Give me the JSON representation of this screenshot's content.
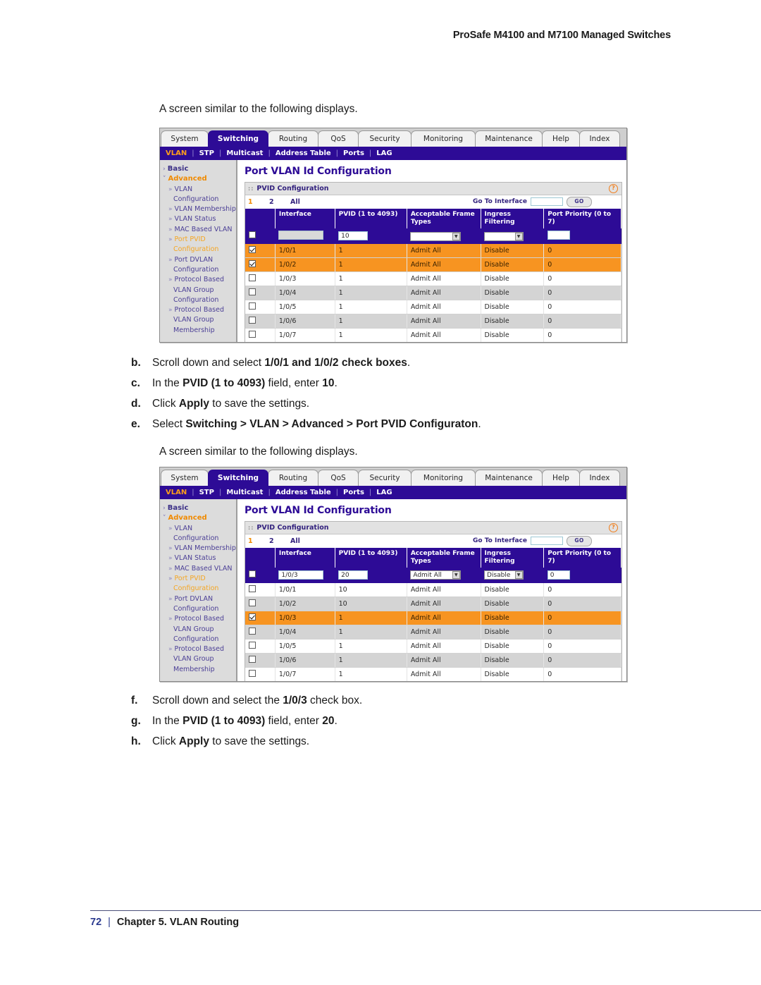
{
  "running_head": "ProSafe M4100 and M7100 Managed Switches",
  "lead_in_1": "A screen similar to the following displays.",
  "lead_in_2": "A screen similar to the following displays.",
  "steps_upper": [
    {
      "marker": "b.",
      "html": "Scroll down and select <b>1/0/1 and 1/0/2 check boxes</b>."
    },
    {
      "marker": "c.",
      "html": "In the <b>PVID (1 to 4093)</b> field, enter <b>10</b>."
    },
    {
      "marker": "d.",
      "html": "Click <b>Apply</b> to save the settings."
    },
    {
      "marker": "e.",
      "html": "Select <b>Switching &gt; VLAN &gt; Advanced &gt; Port PVID Configuraton</b>."
    }
  ],
  "steps_lower": [
    {
      "marker": "f.",
      "html": "Scroll down and select the <b>1/0/3</b> check box."
    },
    {
      "marker": "g.",
      "html": "In the <b>PVID (1 to 4093)</b> field, enter <b>20</b>."
    },
    {
      "marker": "h.",
      "html": "Click <b>Apply</b> to save the settings."
    }
  ],
  "footer": {
    "page_number": "72",
    "separator": "|",
    "chapter": "Chapter 5.  VLAN Routing"
  },
  "colors": {
    "purple": "#2d0b96",
    "orange_accent": "#f08a00",
    "row_selected": "#f79421",
    "row_alt": "#d4d4d4",
    "sidebar_bg": "#dcdcdc"
  },
  "ui": {
    "tabs": [
      {
        "label": "System",
        "active": false
      },
      {
        "label": "Switching",
        "active": true
      },
      {
        "label": "Routing",
        "active": false
      },
      {
        "label": "QoS",
        "active": false
      },
      {
        "label": "Security",
        "active": false
      },
      {
        "label": "Monitoring",
        "active": false
      },
      {
        "label": "Maintenance",
        "active": false
      },
      {
        "label": "Help",
        "active": false
      },
      {
        "label": "Index",
        "active": false
      }
    ],
    "subnav": [
      {
        "label": "VLAN",
        "active": true
      },
      {
        "label": "STP",
        "active": false
      },
      {
        "label": "Multicast",
        "active": false
      },
      {
        "label": "Address Table",
        "active": false
      },
      {
        "label": "Ports",
        "active": false
      },
      {
        "label": "LAG",
        "active": false
      }
    ],
    "sidebar": [
      "Basic",
      "Advanced",
      "VLAN",
      "Configuration",
      "VLAN Membership",
      "VLAN Status",
      "MAC Based VLAN",
      "Port PVID",
      "Configuration",
      "Port DVLAN",
      "Configuration",
      "Protocol Based",
      "VLAN Group",
      "Configuration",
      "Protocol Based",
      "VLAN Group",
      "Membership"
    ],
    "page_title": "Port VLAN Id Configuration",
    "panel_title": "PVID Configuration",
    "pager": {
      "p1": "1",
      "p2": "2",
      "all": "All"
    },
    "goto_label": "Go To Interface",
    "goto_value": "",
    "go_button": "GO",
    "help_icon": "?",
    "columns": [
      "",
      "Interface",
      "PVID (1 to 4093)",
      "Acceptable Frame Types",
      "Ingress Filtering",
      "Port Priority (0 to 7)"
    ]
  },
  "screenshot_1": {
    "edit_row": {
      "checked": false,
      "interface": "",
      "interface_disabled": true,
      "pvid": "10",
      "frame_types": "",
      "ingress": "",
      "priority": ""
    },
    "rows": [
      {
        "checked": true,
        "state": "sel",
        "interface": "1/0/1",
        "pvid": "1",
        "frame": "Admit All",
        "ingress": "Disable",
        "priority": "0"
      },
      {
        "checked": true,
        "state": "sel",
        "interface": "1/0/2",
        "pvid": "1",
        "frame": "Admit All",
        "ingress": "Disable",
        "priority": "0"
      },
      {
        "checked": false,
        "state": "white",
        "interface": "1/0/3",
        "pvid": "1",
        "frame": "Admit All",
        "ingress": "Disable",
        "priority": "0"
      },
      {
        "checked": false,
        "state": "alt",
        "interface": "1/0/4",
        "pvid": "1",
        "frame": "Admit All",
        "ingress": "Disable",
        "priority": "0"
      },
      {
        "checked": false,
        "state": "white",
        "interface": "1/0/5",
        "pvid": "1",
        "frame": "Admit All",
        "ingress": "Disable",
        "priority": "0"
      },
      {
        "checked": false,
        "state": "alt",
        "interface": "1/0/6",
        "pvid": "1",
        "frame": "Admit All",
        "ingress": "Disable",
        "priority": "0"
      },
      {
        "checked": false,
        "state": "white",
        "interface": "1/0/7",
        "pvid": "1",
        "frame": "Admit All",
        "ingress": "Disable",
        "priority": "0"
      }
    ]
  },
  "screenshot_2": {
    "edit_row": {
      "checked": false,
      "interface": "1/0/3",
      "interface_disabled": false,
      "pvid": "20",
      "frame_types": "Admit All",
      "ingress": "Disable",
      "priority": "0"
    },
    "rows": [
      {
        "checked": false,
        "state": "white",
        "interface": "1/0/1",
        "pvid": "10",
        "frame": "Admit All",
        "ingress": "Disable",
        "priority": "0"
      },
      {
        "checked": false,
        "state": "alt",
        "interface": "1/0/2",
        "pvid": "10",
        "frame": "Admit All",
        "ingress": "Disable",
        "priority": "0"
      },
      {
        "checked": true,
        "state": "sel",
        "interface": "1/0/3",
        "pvid": "1",
        "frame": "Admit All",
        "ingress": "Disable",
        "priority": "0"
      },
      {
        "checked": false,
        "state": "alt",
        "interface": "1/0/4",
        "pvid": "1",
        "frame": "Admit All",
        "ingress": "Disable",
        "priority": "0"
      },
      {
        "checked": false,
        "state": "white",
        "interface": "1/0/5",
        "pvid": "1",
        "frame": "Admit All",
        "ingress": "Disable",
        "priority": "0"
      },
      {
        "checked": false,
        "state": "alt",
        "interface": "1/0/6",
        "pvid": "1",
        "frame": "Admit All",
        "ingress": "Disable",
        "priority": "0"
      },
      {
        "checked": false,
        "state": "white",
        "interface": "1/0/7",
        "pvid": "1",
        "frame": "Admit All",
        "ingress": "Disable",
        "priority": "0"
      }
    ]
  }
}
